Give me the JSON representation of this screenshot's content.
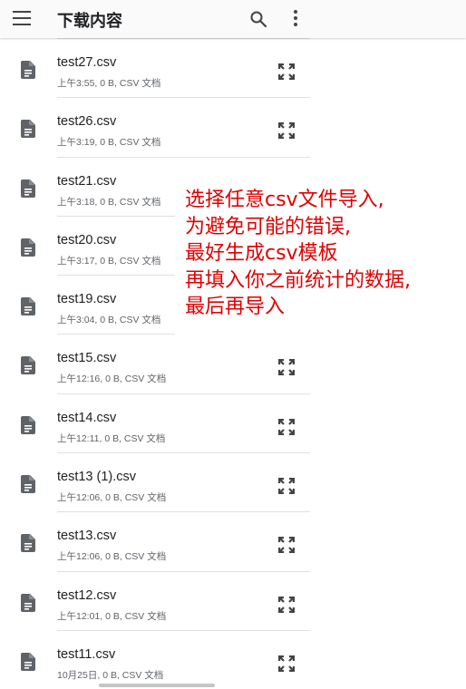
{
  "appbar": {
    "title": "下载内容"
  },
  "files": [
    {
      "name": "test27.csv",
      "meta": "上午3:55, 0 B, CSV 文档"
    },
    {
      "name": "test26.csv",
      "meta": "上午3:19, 0 B, CSV 文档"
    },
    {
      "name": "test21.csv",
      "meta": "上午3:18, 0 B, CSV 文档"
    },
    {
      "name": "test20.csv",
      "meta": "上午3:17, 0 B, CSV 文档"
    },
    {
      "name": "test19.csv",
      "meta": "上午3:04, 0 B, CSV 文档"
    },
    {
      "name": "test15.csv",
      "meta": "上午12:16, 0 B, CSV 文档"
    },
    {
      "name": "test14.csv",
      "meta": "上午12:11, 0 B, CSV 文档"
    },
    {
      "name": "test13 (1).csv",
      "meta": "上午12:06, 0 B, CSV 文档"
    },
    {
      "name": "test13.csv",
      "meta": "上午12:06, 0 B, CSV 文档"
    },
    {
      "name": "test12.csv",
      "meta": "上午12:01, 0 B, CSV 文档"
    },
    {
      "name": "test11.csv",
      "meta": "10月25日, 0 B, CSV 文档"
    }
  ],
  "overlay": {
    "lines": [
      "选择任意csv文件导入,",
      "为避免可能的错误,",
      "最好生成csv模板",
      "再填入你之前统计的数据,",
      "最后再导入"
    ],
    "color": "#e00000"
  }
}
